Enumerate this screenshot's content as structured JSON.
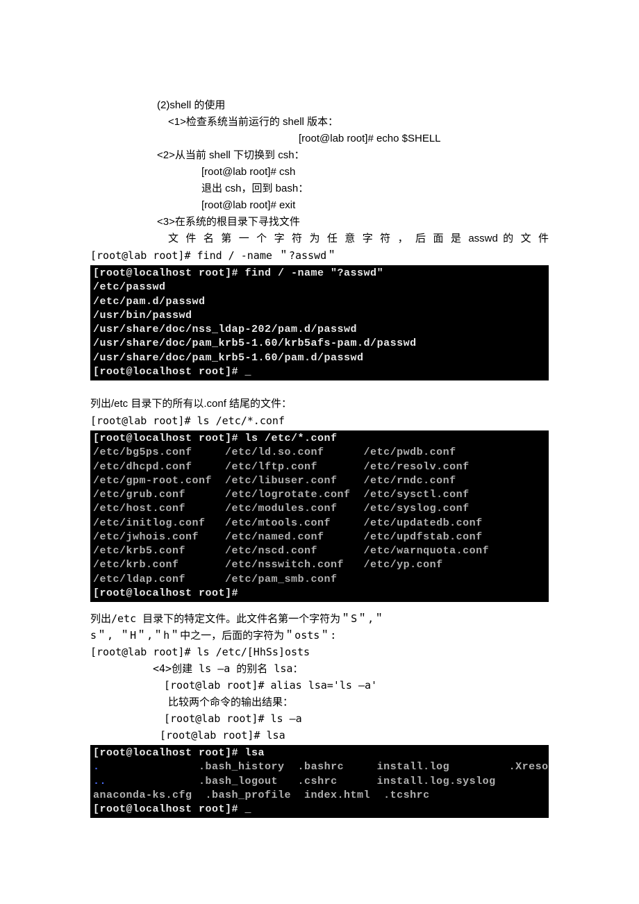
{
  "section2": {
    "title": "(2)shell 的使用",
    "s1": {
      "label": "<1>检查系统当前运行的 shell 版本：",
      "cmd": "[root@lab root]# echo $SHELL"
    },
    "s2": {
      "label": "<2>从当前 shell 下切换到 csh：",
      "cmd1": "[root@lab root]# csh",
      "note1": "退出 csh，回到 bash：",
      "cmd2": "[root@lab root]# exit"
    },
    "s3": {
      "label": "<3>在系统的根目录下寻找文件",
      "desc": "文 件 名 第 一 个 字 符 为 任 意 字 符 ， 后 面 是 asswd 的 文 件",
      "cmd": "[root@lab root]# find / -name ＂?asswd＂"
    },
    "term1": "[root@localhost root]# find / -name \"?asswd\"\n/etc/passwd\n/etc/pam.d/passwd\n/usr/bin/passwd\n/usr/share/doc/nss_ldap-202/pam.d/passwd\n/usr/share/doc/pam_krb5-1.60/krb5afs-pam.d/passwd\n/usr/share/doc/pam_krb5-1.60/pam.d/passwd\n[root@localhost root]# _",
    "list_conf": {
      "desc": "列出/etc 目录下的所有以.conf 结尾的文件：",
      "cmd": "[root@lab root]# ls /etc/*.conf"
    },
    "term2_white": "[root@localhost root]# ls /etc/*.conf",
    "term2_body": "/etc/bg5ps.conf     /etc/ld.so.conf      /etc/pwdb.conf\n/etc/dhcpd.conf     /etc/lftp.conf       /etc/resolv.conf\n/etc/gpm-root.conf  /etc/libuser.conf    /etc/rndc.conf\n/etc/grub.conf      /etc/logrotate.conf  /etc/sysctl.conf\n/etc/host.conf      /etc/modules.conf    /etc/syslog.conf\n/etc/initlog.conf   /etc/mtools.conf     /etc/updatedb.conf\n/etc/jwhois.conf    /etc/named.conf      /etc/updfstab.conf\n/etc/krb5.conf      /etc/nscd.conf       /etc/warnquota.conf\n/etc/krb.conf       /etc/nsswitch.conf   /etc/yp.conf\n/etc/ldap.conf      /etc/pam_smb.conf",
    "term2_prompt": "[root@localhost root]#",
    "hosts": {
      "line1": "  列出/etc 目录下的特定文件。此文件名第一个字符为＂S＂,＂",
      "line2": "s＂,           ＂H＂,＂h＂中之一，后面的字符为＂osts＂:",
      "cmd": "[root@lab root]# ls /etc/[HhSs]osts"
    },
    "s4": {
      "label": "<4>创建 ls –a 的别名 lsa：",
      "cmd1": "[root@lab root]# alias lsa='ls –a'",
      "note1": "比较两个命令的输出结果：",
      "cmd2": "[root@lab root]# ls –a",
      "cmd3": "[root@lab root]# lsa"
    },
    "term3_line1_white": "[root@localhost root]# lsa",
    "term3_row1_blue1": ".",
    "term3_row1_a": "               .bash_history  .bashrc     install.log         .Xresour",
    "term3_row2_blue1": "..",
    "term3_row2_a": "              .bash_logout   .cshrc      install.log.syslog",
    "term3_row3": "anaconda-ks.cfg  .bash_profile  index.html  .tcshrc",
    "term3_prompt": "[root@localhost root]# _"
  }
}
